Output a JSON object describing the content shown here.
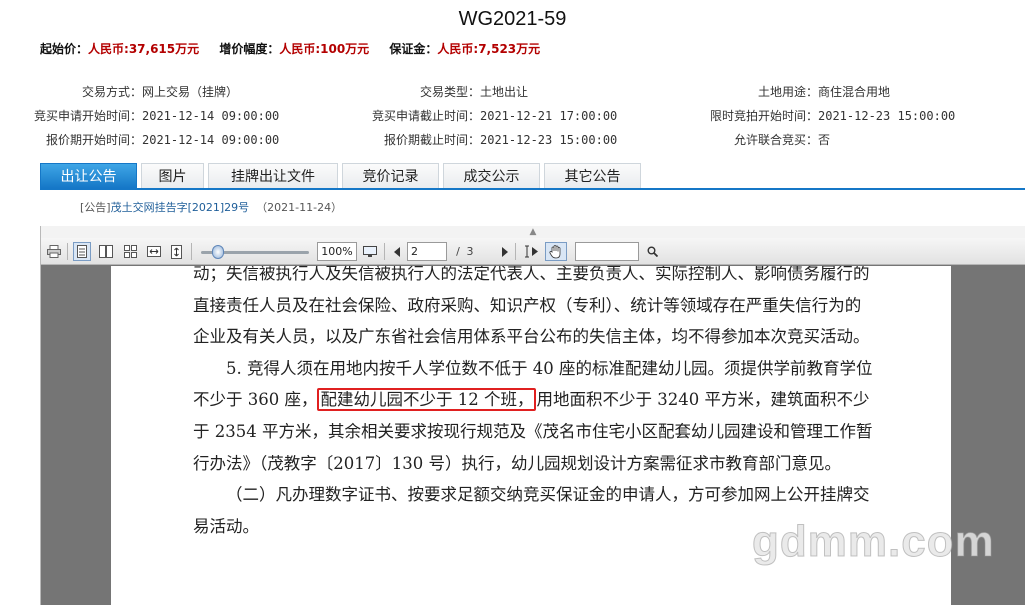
{
  "title": "WG2021-59",
  "prices": {
    "start_label": "起始价：",
    "start_value": "人民币:37,615万元",
    "inc_label": "增价幅度：",
    "inc_value": "人民币:100万元",
    "deposit_label": "保证金：",
    "deposit_value": "人民币:7,523万元"
  },
  "info": {
    "col1": [
      {
        "k": "交易方式：",
        "v": "网上交易（挂牌）"
      },
      {
        "k": "竞买申请开始时间：",
        "v": "2021-12-14 09:00:00"
      },
      {
        "k": "报价期开始时间：",
        "v": "2021-12-14 09:00:00"
      }
    ],
    "col2": [
      {
        "k": "交易类型：",
        "v": "土地出让"
      },
      {
        "k": "竞买申请截止时间：",
        "v": "2021-12-21 17:00:00"
      },
      {
        "k": "报价期截止时间：",
        "v": "2021-12-23 15:00:00"
      }
    ],
    "col3": [
      {
        "k": "土地用途：",
        "v": "商住混合用地"
      },
      {
        "k": "限时竞拍开始时间：",
        "v": "2021-12-23 15:00:00"
      },
      {
        "k": "允许联合竞买：",
        "v": "否"
      }
    ]
  },
  "tabs": [
    "出让公告",
    "图片",
    "挂牌出让文件",
    "竞价记录",
    "成交公示",
    "其它公告"
  ],
  "notice": {
    "prefix": "[公告]",
    "link": "茂土交网挂告字[2021]29号",
    "date": "（2021-11-24）"
  },
  "viewer": {
    "zoom": "100%",
    "page_current": "2",
    "page_sep": "/",
    "page_total": "3",
    "search_value": "",
    "collapse_glyph": "▲"
  },
  "doc": {
    "p1": "动；失信被执行人及失信被执行人的法定代表人、主要负责人、实际控制人、影响债务履行的直接责任人员及在社会保险、政府采购、知识产权（专利）、统计等领域存在严重失信行为的企业及有关人员，以及广东省社会信用体系平台公布的失信主体，均不得参加本次竞买活动。",
    "p2_before": "5. 竞得人须在用地内按千人学位数不低于 40 座的标准配建幼儿园。须提供学前教育学位不少于 360 座，",
    "p2_highlight": "配建幼儿园不少于 12 个班，",
    "p2_after": "用地面积不少于 3240 平方米，建筑面积不少于 2354 平方米，其余相关要求按现行规范及《茂名市住宅小区配套幼儿园建设和管理工作暂行办法》（茂教字〔2017〕130 号）执行，幼儿园规划设计方案需征求市教育部门意见。",
    "p3": "（二）凡办理数字证书、按要求足额交纳竞买保证金的申请人，方可参加网上公开挂牌交易活动。"
  },
  "watermark": "gdmm.com"
}
